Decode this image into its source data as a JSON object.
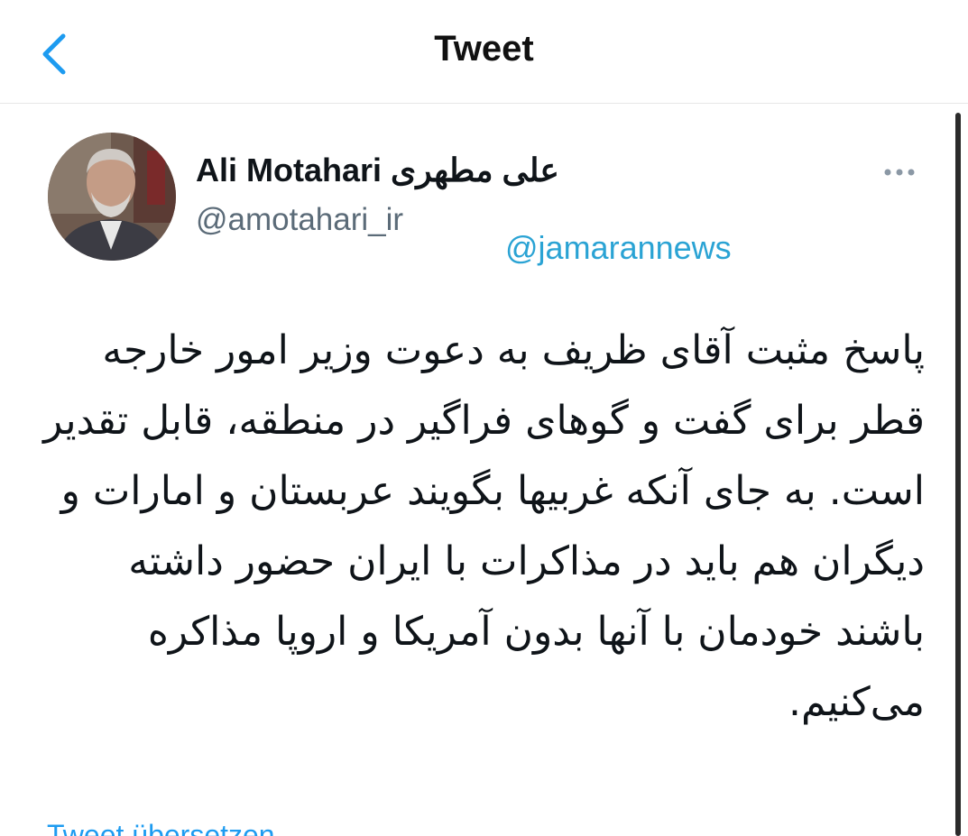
{
  "header": {
    "title": "Tweet",
    "back_icon": "chevron-left-icon",
    "accent_color": "#1d9bf0"
  },
  "tweet": {
    "author_name": "Ali Motahari علی مطهری",
    "author_handle": "@amotahari_ir",
    "more_icon": "ellipsis-icon",
    "watermark": "@jamarannews",
    "text": "پاسخ مثبت آقای ظریف به دعوت وزیر امور خارجه قطر برای گفت و گوهای فراگیر در منطقه، قابل تقدیر است. به جای آنکه غربیها بگویند عربستان و امارات و دیگران هم باید در مذاکرات با ایران حضور داشته باشند خودمان با آنها بدون آمریکا و اروپا مذاکره می‌کنیم.",
    "translate_label": "Tweet übersetzen"
  }
}
